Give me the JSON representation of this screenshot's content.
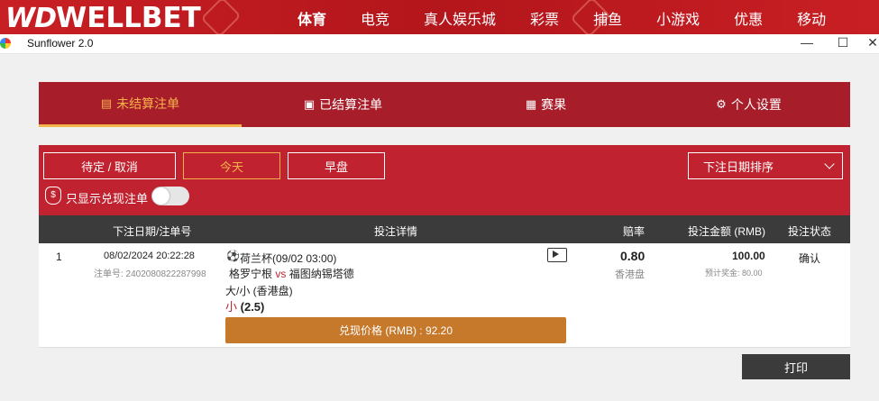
{
  "site": {
    "logo_mark": "WD",
    "logo_text": "WELLBET",
    "nav": [
      {
        "label": "体育",
        "bold": true
      },
      {
        "label": "电竞"
      },
      {
        "label": "真人娱乐城"
      },
      {
        "label": "彩票"
      },
      {
        "label": "捕鱼"
      },
      {
        "label": "小游戏"
      },
      {
        "label": "优惠"
      },
      {
        "label": "移动"
      }
    ]
  },
  "window": {
    "title": "Sunflower 2.0",
    "minimize": "—",
    "maximize": "☐",
    "close": "✕"
  },
  "tabs": [
    {
      "label": "未结算注单",
      "icon": "list-icon",
      "glyph": "▤"
    },
    {
      "label": "已结算注单",
      "icon": "settled-icon",
      "glyph": "▣"
    },
    {
      "label": "赛果",
      "icon": "scoreboard-icon",
      "glyph": "▦"
    },
    {
      "label": "个人设置",
      "icon": "gear-icon",
      "glyph": "⚙"
    }
  ],
  "filters": {
    "pending": "待定 / 取消",
    "today": "今天",
    "early": "早盘",
    "sort": "下注日期排序",
    "toggle_label": "只显示兑现注单",
    "bag_glyph": "$"
  },
  "table": {
    "headers": {
      "date": "下注日期/注单号",
      "details": "投注详情",
      "odds": "赔率",
      "stake": "投注金额 (RMB)",
      "status": "投注状态"
    },
    "rows": [
      {
        "index": "1",
        "datetime": "08/02/2024 20:22:28",
        "ticket": "注单号: 2402080822287998",
        "league": "荷兰杯(09/02 03:00)",
        "home": "格罗宁根",
        "vs": "vs",
        "away": "福图纳锡塔德",
        "market": "大/小 (香港盘)",
        "selection": "小",
        "line": "(2.5)",
        "odds": "0.80",
        "odds_type": "香港盘",
        "stake": "100.00",
        "est_payout": "预计奖金: 80.00",
        "status": "确认",
        "cashout": "兑现价格 (RMB) : 92.20"
      }
    ]
  },
  "print": "打印"
}
